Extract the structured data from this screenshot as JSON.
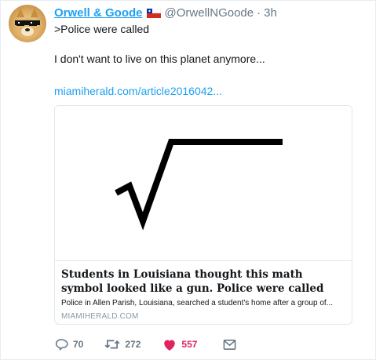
{
  "tweet": {
    "display_name": "Orwell & Goode",
    "handle": "@OrwellNGoode",
    "separator": "·",
    "time": "3h",
    "flag_icon": "chile-flag-icon",
    "text_line1": ">Police were called",
    "text_line2": "I don't want to live on this planet anymore...",
    "link_text": "miamiherald.com/article2016042...",
    "link_color": "#1da1f2"
  },
  "card": {
    "title": "Students in Louisiana thought this math symbol looked like a gun. Police were called",
    "description": "Police in Allen Parish, Louisiana, searched a student's home after a group of...",
    "domain": "MIAMIHERALD.COM",
    "image_icon": "square-root-symbol-icon"
  },
  "actions": {
    "reply": {
      "icon": "reply-icon",
      "count": "70"
    },
    "retweet": {
      "icon": "retweet-icon",
      "count": "272"
    },
    "like": {
      "icon": "heart-icon",
      "count": "557",
      "color": "#e0245e"
    },
    "dm": {
      "icon": "envelope-icon"
    }
  }
}
